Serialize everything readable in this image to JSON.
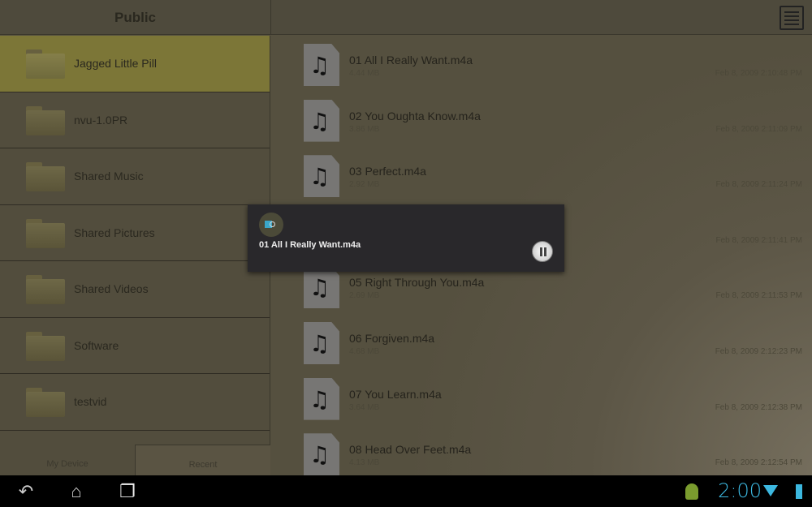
{
  "header": {
    "title": "Public",
    "menu_icon": "list-view-icon"
  },
  "folders": [
    {
      "name": "Jagged Little Pill",
      "selected": true
    },
    {
      "name": "nvu-1.0PR"
    },
    {
      "name": "Shared Music"
    },
    {
      "name": "Shared Pictures"
    },
    {
      "name": "Shared Videos"
    },
    {
      "name": "Software"
    },
    {
      "name": "testvid"
    }
  ],
  "bottom_tabs": [
    "My Device",
    "Recent"
  ],
  "files": [
    {
      "name": "01 All I Really Want.m4a",
      "size": "4.44 MB",
      "date": "Feb 8, 2009 2:10:48 PM"
    },
    {
      "name": "02 You Oughta Know.m4a",
      "size": "3.86 MB",
      "date": "Feb 8, 2009 2:11:09 PM"
    },
    {
      "name": "03 Perfect.m4a",
      "size": "2.92 MB",
      "date": "Feb 8, 2009 2:11:24 PM"
    },
    {
      "name": "",
      "size": "",
      "date": "Feb 8, 2009 2:11:41 PM"
    },
    {
      "name": "05 Right Through You.m4a",
      "size": "2.69 MB",
      "date": "Feb 8, 2009 2:11:53 PM"
    },
    {
      "name": "06 Forgiven.m4a",
      "size": "4.68 MB",
      "date": "Feb 8, 2009 2:12:23 PM"
    },
    {
      "name": "07 You Learn.m4a",
      "size": "3.64 MB",
      "date": "Feb 8, 2009 2:12:38 PM"
    },
    {
      "name": "08 Head Over Feet.m4a",
      "size": "4.13 MB",
      "date": "Feb 8, 2009 2:12:54 PM"
    }
  ],
  "popup": {
    "title": "01 All I Really Want.m4a",
    "button_icon": "pause-icon"
  },
  "navbar": {
    "time": "2:00",
    "accent": "#3cb8e0"
  }
}
